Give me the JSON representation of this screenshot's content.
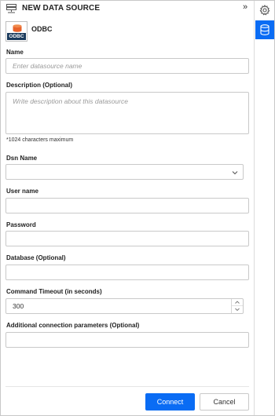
{
  "header": {
    "title": "NEW DATA SOURCE",
    "collapse_glyph": "»"
  },
  "datasource_type": {
    "badge": "ODBC",
    "name": "ODBC"
  },
  "form": {
    "name_label": "Name",
    "name_placeholder": "Enter datasource name",
    "name_value": "",
    "description_label": "Description (Optional)",
    "description_placeholder": "Write description about this datasource",
    "description_hint": "*1024 characters maximum",
    "dsn_label": "Dsn Name",
    "dsn_value": "",
    "username_label": "User name",
    "username_value": "",
    "password_label": "Password",
    "password_value": "",
    "database_label": "Database (Optional)",
    "database_value": "",
    "timeout_label": "Command Timeout (in seconds)",
    "timeout_value": "300",
    "additional_label": "Additional connection parameters (Optional)",
    "additional_value": ""
  },
  "footer": {
    "connect_label": "Connect",
    "cancel_label": "Cancel"
  },
  "colors": {
    "accent": "#0a6cf4",
    "badge_bg": "#1a3a5c",
    "db_icon_orange": "#e8632b"
  },
  "icons": {
    "header": "datasource-icon",
    "collapse": "double-chevron-right-icon",
    "settings": "gear-icon",
    "data": "database-icon",
    "dropdown": "chevron-down-icon"
  }
}
